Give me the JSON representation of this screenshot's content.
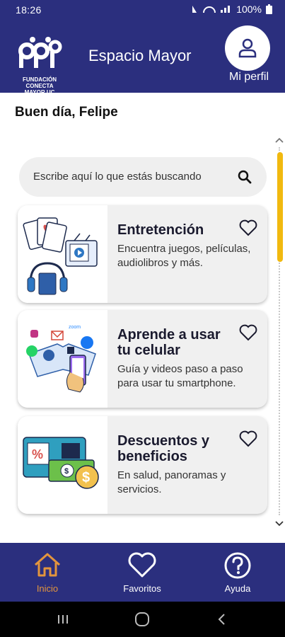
{
  "status_bar": {
    "time": "18:26",
    "battery": "100%"
  },
  "header": {
    "title": "Espacio Mayor",
    "logo_text": "FUNDACIÓN CONECTA MAYOR UC",
    "profile_label": "Mi perfil"
  },
  "greeting": "Buen día, Felipe",
  "search": {
    "placeholder": "Escribe aquí lo que estás buscando"
  },
  "cards": [
    {
      "title": "Entretención",
      "description": "Encuentra juegos, películas, audiolibros y más."
    },
    {
      "title": "Aprende a usar tu celular",
      "description": "Guía y videos paso a paso para usar tu smartphone."
    },
    {
      "title": "Descuentos y beneficios",
      "description": "En salud, panoramas y servicios."
    }
  ],
  "bottom_nav": [
    {
      "label": "Inicio",
      "active": true
    },
    {
      "label": "Favoritos",
      "active": false
    },
    {
      "label": "Ayuda",
      "active": false
    }
  ],
  "colors": {
    "brand": "#2b2f7e",
    "accent": "#e3953d",
    "scroll": "#f1b90f"
  },
  "icons": {
    "search": "search-icon",
    "heart": "heart-icon",
    "home": "home-icon",
    "help": "help-icon",
    "profile": "profile-icon"
  }
}
